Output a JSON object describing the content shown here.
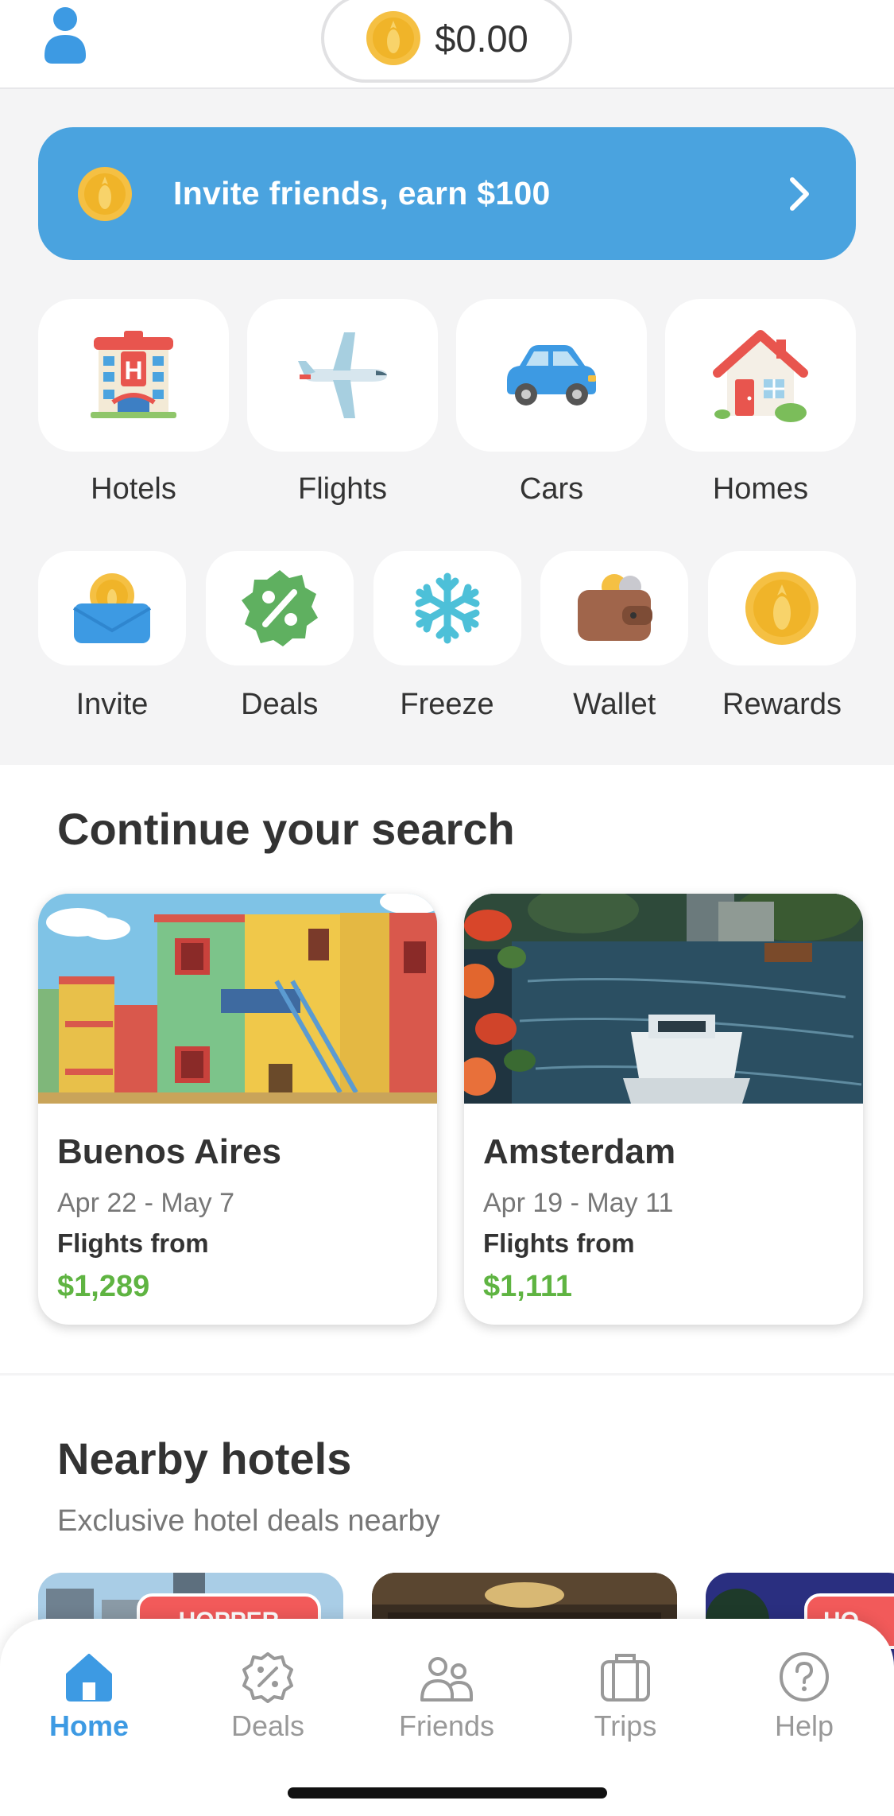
{
  "colors": {
    "accent": "#4aa3df",
    "price_green": "#5fb442",
    "coin_yellow": "#f5c043",
    "tab_active": "#3d9ae3",
    "tab_inactive": "#999999",
    "badge_red": "#f25a5a"
  },
  "header": {
    "profile_icon": "user-icon",
    "balance": "$0.00",
    "balance_icon": "coin-icon"
  },
  "invite_banner": {
    "text": "Invite friends, earn $100",
    "icon": "coin-icon",
    "chevron": "chevron-right-icon"
  },
  "categories": [
    {
      "label": "Hotels",
      "icon": "hotel-icon"
    },
    {
      "label": "Flights",
      "icon": "airplane-icon"
    },
    {
      "label": "Cars",
      "icon": "car-icon"
    },
    {
      "label": "Homes",
      "icon": "house-icon"
    }
  ],
  "quick_actions": [
    {
      "label": "Invite",
      "icon": "invite-envelope-icon"
    },
    {
      "label": "Deals",
      "icon": "deals-percent-icon"
    },
    {
      "label": "Freeze",
      "icon": "snowflake-icon"
    },
    {
      "label": "Wallet",
      "icon": "wallet-icon"
    },
    {
      "label": "Rewards",
      "icon": "coin-icon"
    }
  ],
  "continue_search": {
    "title": "Continue your search",
    "cards": [
      {
        "city": "Buenos Aires",
        "dates": "Apr 22 - May 7",
        "label": "Flights from",
        "price": "$1,289"
      },
      {
        "city": "Amsterdam",
        "dates": "Apr 19 - May 11",
        "label": "Flights from",
        "price": "$1,111"
      }
    ]
  },
  "nearby_hotels": {
    "title": "Nearby hotels",
    "subtitle": "Exclusive hotel deals nearby",
    "badge": "HOPPER",
    "badge_partial": "HO"
  },
  "tabs": [
    {
      "label": "Home",
      "icon": "home-icon",
      "active": true
    },
    {
      "label": "Deals",
      "icon": "deals-icon",
      "active": false
    },
    {
      "label": "Friends",
      "icon": "friends-icon",
      "active": false
    },
    {
      "label": "Trips",
      "icon": "suitcase-icon",
      "active": false
    },
    {
      "label": "Help",
      "icon": "help-icon",
      "active": false
    }
  ]
}
